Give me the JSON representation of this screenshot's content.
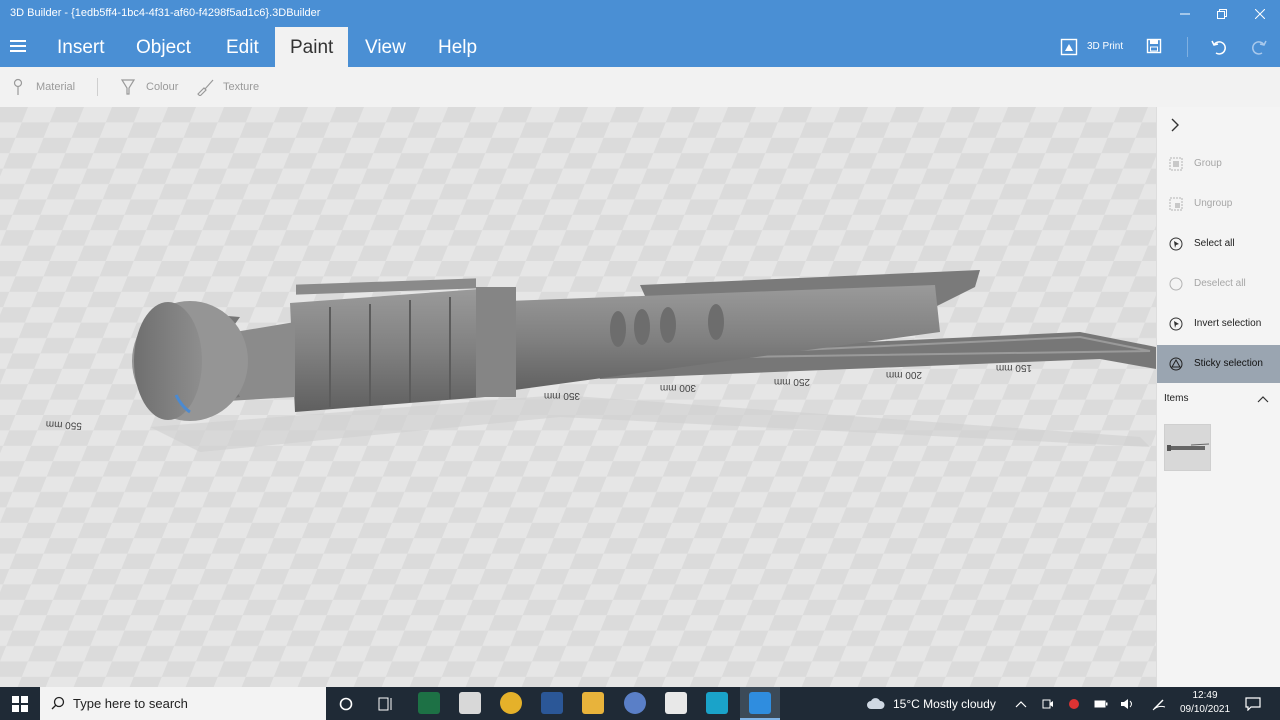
{
  "window": {
    "title": "3D Builder - {1edb5ff4-1bc4-4f31-af60-f4298f5ad1c6}.3DBuilder",
    "minimize_icon": "minimize-icon",
    "maximize_icon": "restore-icon",
    "close_icon": "close-icon"
  },
  "ribbon": {
    "tabs": [
      {
        "label": "Insert"
      },
      {
        "label": "Object"
      },
      {
        "label": "Edit"
      },
      {
        "label": "Paint"
      },
      {
        "label": "View"
      },
      {
        "label": "Help"
      }
    ],
    "active_tab": "Paint",
    "print_label": "3D Print"
  },
  "toolbar": {
    "material_label": "Material",
    "colour_label": "Colour",
    "texture_label": "Texture"
  },
  "scene": {
    "ruler_labels": [
      "550 mm",
      "350 mm",
      "300 mm",
      "250 mm",
      "200 mm",
      "150 mm"
    ]
  },
  "panel": {
    "group_label": "Group",
    "ungroup_label": "Ungroup",
    "select_all_label": "Select all",
    "deselect_all_label": "Deselect all",
    "invert_selection_label": "Invert selection",
    "sticky_selection_label": "Sticky selection",
    "items_label": "Items"
  },
  "taskbar": {
    "search_placeholder": "Type here to search",
    "weather": "15°C  Mostly cloudy",
    "time": "12:49",
    "date": "09/10/2021"
  },
  "colors": {
    "accent": "#4a8fd4",
    "active_panel": "#9aa5b1",
    "model": "#7d7d7d"
  }
}
